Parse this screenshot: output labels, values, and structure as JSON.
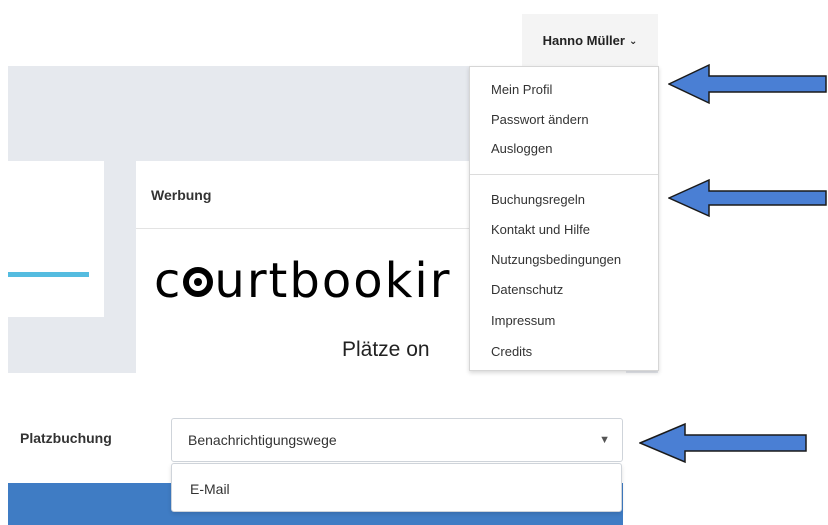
{
  "header": {
    "user_name": "Hanno Müller"
  },
  "user_menu": {
    "account_items": [
      {
        "label": "Mein Profil"
      },
      {
        "label": "Passwort ändern"
      },
      {
        "label": "Ausloggen"
      }
    ],
    "info_items": [
      {
        "label": "Buchungsregeln"
      },
      {
        "label": "Kontakt und Hilfe"
      },
      {
        "label": "Nutzungsbedingungen"
      },
      {
        "label": "Datenschutz"
      },
      {
        "label": "Impressum"
      },
      {
        "label": "Credits"
      }
    ]
  },
  "ad": {
    "header": "Werbung",
    "logo_text_start": "c",
    "logo_text_end": "urtbookir",
    "tagline": "Plätze on"
  },
  "booking": {
    "label": "Platzbuchung",
    "select_value": "Benachrichtigungswege",
    "options": [
      "E-Mail"
    ]
  },
  "colors": {
    "arrow_fill": "#4a7fd4",
    "accent_line": "#55bce0",
    "button_blue": "#3f7cc4"
  }
}
